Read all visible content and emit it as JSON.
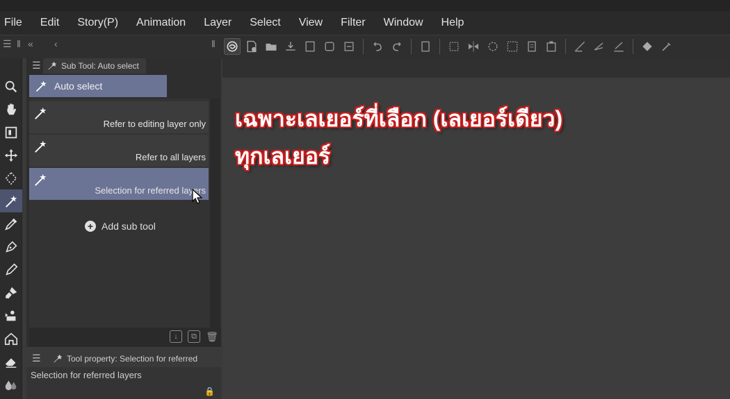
{
  "menu": [
    "File",
    "Edit",
    "Story(P)",
    "Animation",
    "Layer",
    "Select",
    "View",
    "Filter",
    "Window",
    "Help"
  ],
  "subtool_panel": {
    "tab_title": "Sub Tool: Auto select",
    "group_label": "Auto select",
    "items": [
      {
        "label": "Refer to editing layer only",
        "selected": false
      },
      {
        "label": "Refer to all layers",
        "selected": false
      },
      {
        "label": "Selection for referred layers",
        "selected": true
      }
    ],
    "add_label": "Add sub tool"
  },
  "tool_property": {
    "tab_title": "Tool property: Selection for referred",
    "body_title": "Selection for referred layers"
  },
  "captions": {
    "line1": "เฉพาะเลเยอร์ที่เลือก (เลเยอร์เดียว)",
    "line2": "ทุกเลเยอร์"
  },
  "colors": {
    "selection": "#6c7496",
    "caption_outline": "#c41e1e",
    "canvas_bg": "#3d3d3d"
  },
  "icons": {
    "tools": [
      "zoom-icon",
      "hand-icon",
      "navigator-icon",
      "move-icon",
      "lasso-select-icon",
      "auto-select-wand-icon",
      "eyedropper-icon",
      "pen-icon",
      "pencil-icon",
      "brush-icon",
      "fill-icon",
      "figure-icon",
      "eraser-icon",
      "blend-icon"
    ]
  }
}
